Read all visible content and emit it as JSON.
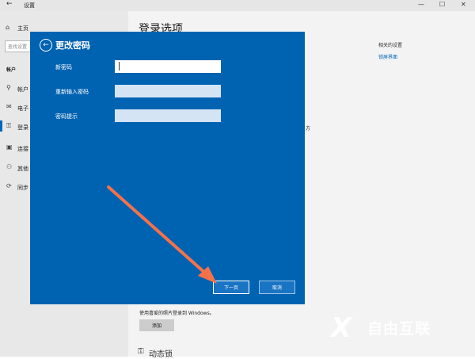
{
  "window": {
    "title": "设置",
    "back_icon": "←",
    "controls": [
      "—",
      "☐",
      "✕"
    ]
  },
  "sidebar": {
    "home_icon": "⌂",
    "home_label": "主页",
    "search_placeholder": "查找设置",
    "section": "帐户",
    "items": [
      {
        "icon": "person-card-icon",
        "glyph": "⚲",
        "label": "帐户"
      },
      {
        "icon": "mail-icon",
        "glyph": "✉",
        "label": "电子"
      },
      {
        "icon": "key-icon",
        "glyph": "⚿",
        "label": "登录"
      },
      {
        "icon": "briefcase-icon",
        "glyph": "▣",
        "label": "连接"
      },
      {
        "icon": "people-icon",
        "glyph": "⚇",
        "label": "其他"
      },
      {
        "icon": "sync-icon",
        "glyph": "⟳",
        "label": "同步"
      }
    ]
  },
  "main": {
    "page_title": "登录选项",
    "related_title": "相关的设置",
    "related_link": "锁屏界面",
    "stray_text": "方",
    "photo_text": "使用喜爱的照片登录到 Windows。",
    "add_button": "添加",
    "dynamic_lock": "动态锁"
  },
  "dialog": {
    "back_icon": "←",
    "title": "更改密码",
    "fields": [
      {
        "label": "新密码",
        "value": ""
      },
      {
        "label": "重新输入密码",
        "value": ""
      },
      {
        "label": "密码提示",
        "value": ""
      }
    ],
    "next_button": "下一页",
    "cancel_button": "取消"
  },
  "annotation": {
    "arrow_color": "#f4714a"
  },
  "watermark": {
    "mark": "X",
    "text": "自由互联"
  }
}
